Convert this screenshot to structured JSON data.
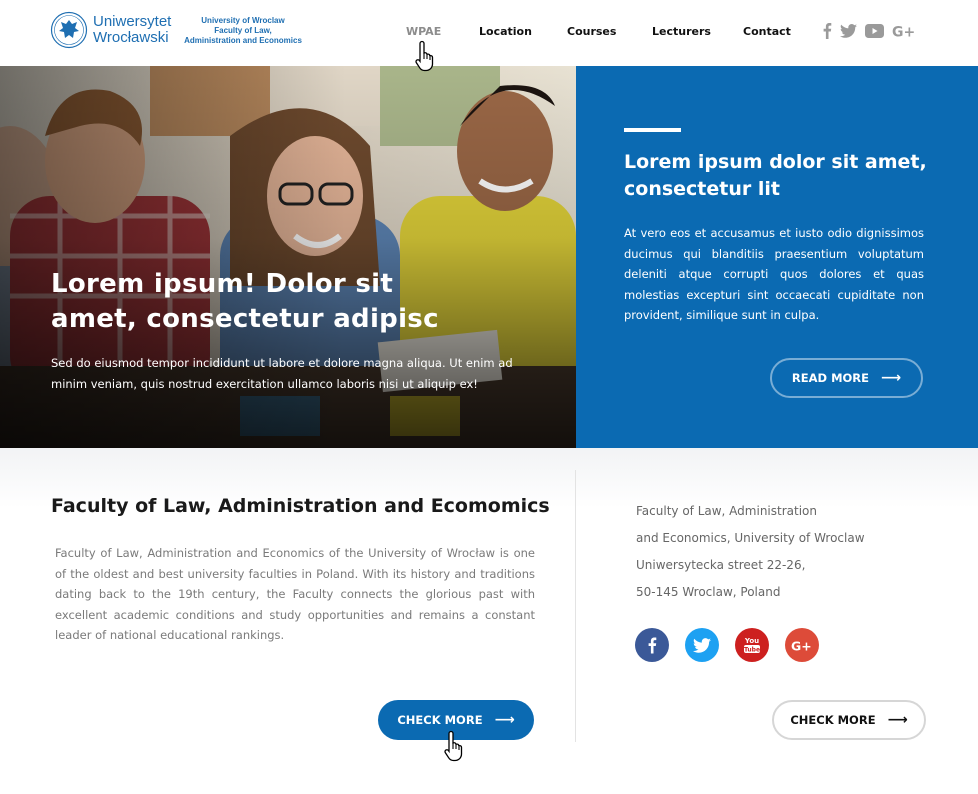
{
  "header": {
    "logo_line1": "Uniwersytet",
    "logo_line2": "Wrocławski",
    "faculty_line1": "University of Wroclaw",
    "faculty_line2": "Faculty of Law,",
    "faculty_line3": "Administration and Economics",
    "nav": [
      "WPAE",
      "Location",
      "Courses",
      "Lecturers",
      "Contact"
    ],
    "active_nav": "WPAE",
    "social_icons": [
      "facebook-icon",
      "twitter-icon",
      "youtube-icon",
      "google-plus-icon"
    ]
  },
  "hero": {
    "title": "Lorem ipsum! Dolor sit amet, consectetur adipisc",
    "text": "Sed do eiusmod tempor incididunt ut labore et dolore magna aliqua. Ut enim ad minim veniam, quis nostrud exercitation ullamco laboris nisi ut aliquip ex!"
  },
  "feature": {
    "title": "Lorem ipsum dolor sit amet, consectetur lit",
    "text": "At vero eos et accusamus et iusto odio dignissimos ducimus qui blanditiis praesentium voluptatum deleniti atque corrupti quos dolores et quas molestias excepturi sint occaecati cupiditate non provident, similique sunt in culpa.",
    "button_label": "READ MORE",
    "button_arrow": "⟶"
  },
  "about": {
    "heading": "Faculty of Law, Administration and Ecomomics",
    "text": "Faculty of Law, Administration and Economics of the University of Wrocław is one of the oldest and best university faculties in Poland. With its history and traditions dating back to the 19th century, the Faculty connects the glorious past with excellent academic conditions and study opportunities and remains a constant leader of national educational rankings.",
    "button_label": "CHECK MORE",
    "button_arrow": "⟶"
  },
  "contact": {
    "address_lines": [
      "Faculty of Law, Administration",
      "and Economics, University of Wroclaw",
      "Uniwersytecka street 22-26,",
      "50-145 Wroclaw, Poland"
    ],
    "button_label": "CHECK MORE",
    "button_arrow": "⟶",
    "social": [
      {
        "icon": "facebook-icon",
        "color": "#3b5998"
      },
      {
        "icon": "twitter-icon",
        "color": "#1da1f2"
      },
      {
        "icon": "youtube-icon",
        "color": "#cd201f"
      },
      {
        "icon": "google-plus-icon",
        "color": "#dd4b39"
      }
    ]
  },
  "colors": {
    "brand_blue": "#0b6ab2",
    "logo_blue": "#1f6fb2"
  }
}
